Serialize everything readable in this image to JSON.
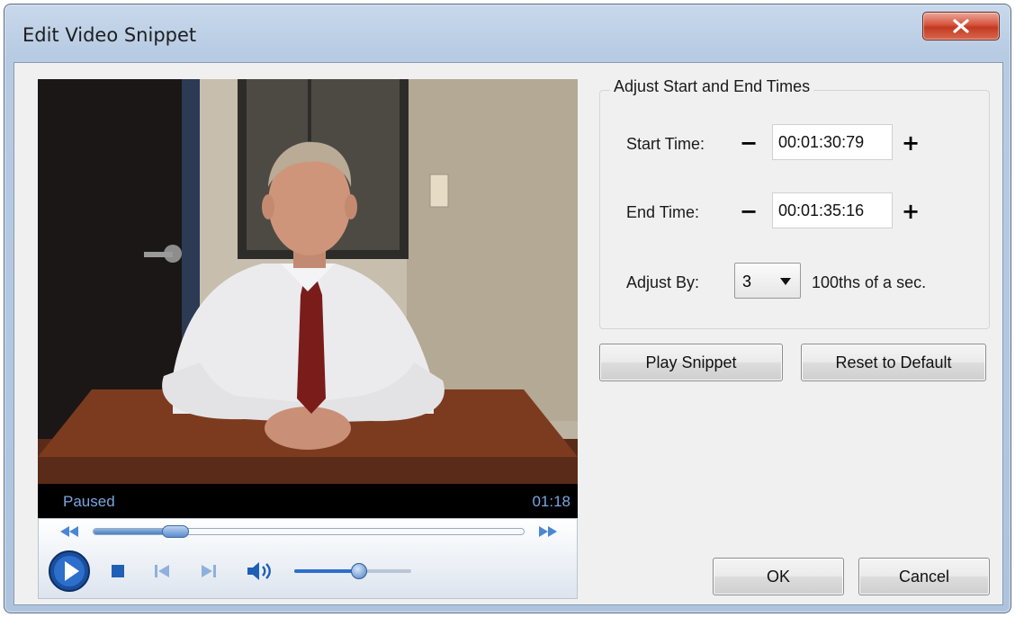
{
  "window": {
    "title": "Edit Video Snippet",
    "close_icon": "close-icon"
  },
  "player": {
    "status": "Paused",
    "time": "01:18",
    "seek_position": 0.19,
    "volume_level": 0.55
  },
  "adjust_group": {
    "title": "Adjust Start and End Times",
    "start_label": "Start Time:",
    "start_value": "00:01:30:79",
    "end_label": "End Time:",
    "end_value": "00:01:35:16",
    "adjust_label": "Adjust By:",
    "adjust_value": "3",
    "adjust_unit": "100ths of a sec."
  },
  "buttons": {
    "play_snippet": "Play Snippet",
    "reset_default": "Reset to Default",
    "ok": "OK",
    "cancel": "Cancel"
  },
  "colors": {
    "close_red": "#c13a22",
    "status_text": "#7aa6de",
    "player_blue": "#2d6fcb"
  }
}
